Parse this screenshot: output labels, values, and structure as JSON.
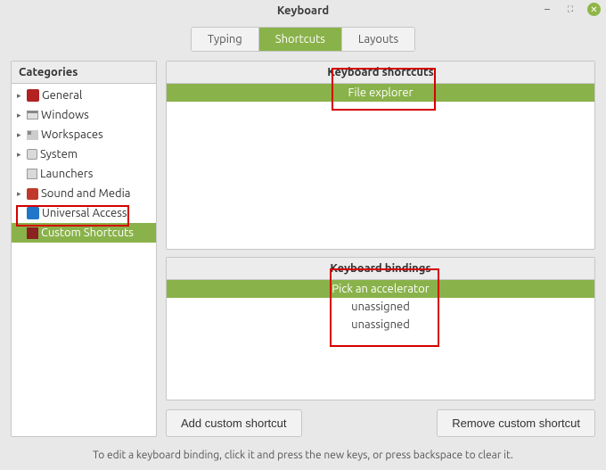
{
  "window": {
    "title": "Keyboard"
  },
  "tabs": {
    "typing": "Typing",
    "shortcuts": "Shortcuts",
    "layouts": "Layouts"
  },
  "sidebar": {
    "header": "Categories",
    "items": [
      {
        "label": "General"
      },
      {
        "label": "Windows"
      },
      {
        "label": "Workspaces"
      },
      {
        "label": "System"
      },
      {
        "label": "Launchers"
      },
      {
        "label": "Sound and Media"
      },
      {
        "label": "Universal Access"
      },
      {
        "label": "Custom Shortcuts"
      }
    ]
  },
  "shortcuts": {
    "header": "Keyboard shortcuts",
    "rows": [
      {
        "label": "File explorer"
      }
    ]
  },
  "bindings": {
    "header": "Keyboard bindings",
    "rows": [
      {
        "label": "Pick an accelerator"
      },
      {
        "label": "unassigned"
      },
      {
        "label": "unassigned"
      }
    ]
  },
  "buttons": {
    "add": "Add custom shortcut",
    "remove": "Remove custom shortcut"
  },
  "footer": "To edit a keyboard binding, click it and press the new keys, or press backspace to clear it."
}
